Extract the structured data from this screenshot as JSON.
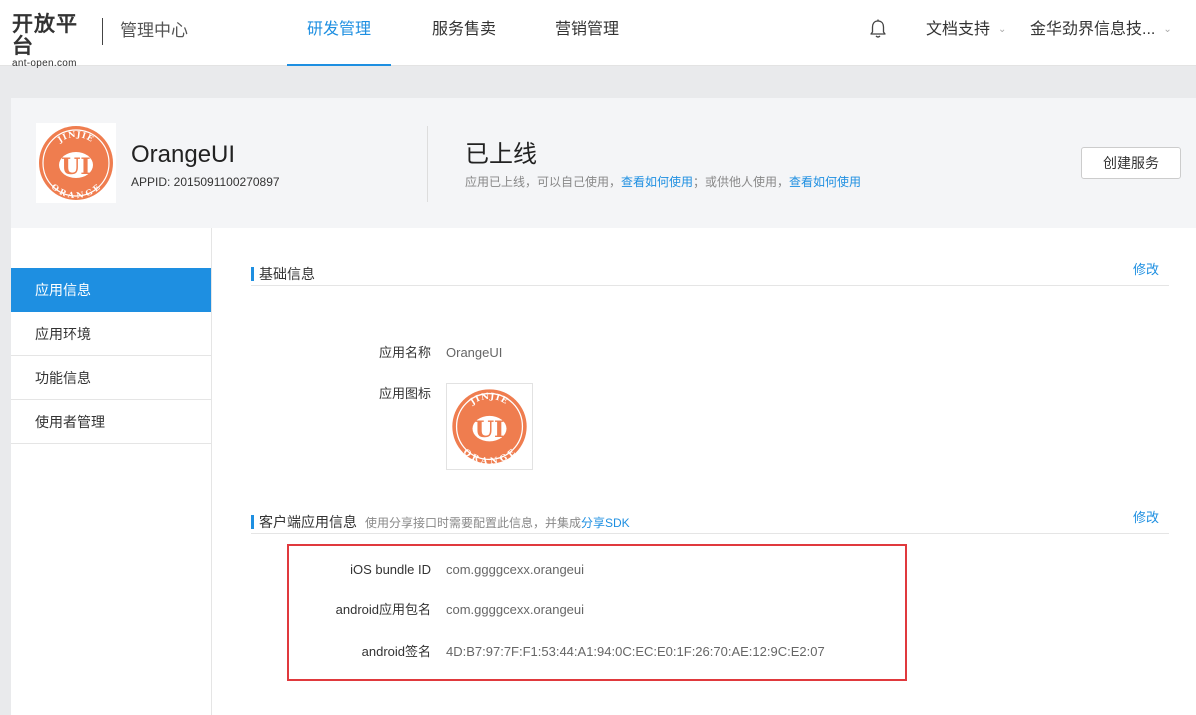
{
  "topbar": {
    "logo_main": "开放平台",
    "logo_sub": "ant-open.com",
    "mgmt_center": "管理中心",
    "nav": [
      {
        "label": "研发管理",
        "active": true
      },
      {
        "label": "服务售卖",
        "active": false
      },
      {
        "label": "营销管理",
        "active": false
      }
    ],
    "docs_label": "文档支持",
    "account_label": "金华劲界信息技..."
  },
  "app": {
    "logo_text_top": "JINJIE",
    "logo_text_mid": "UI",
    "logo_text_bottom": "ORANGE",
    "name": "OrangeUI",
    "appid": "APPID: 2015091100270897",
    "status_title": "已上线",
    "status_desc_1": "应用已上线，可以自己使用，",
    "status_link_1": "查看如何使用",
    "status_desc_2": "；或供他人使用，",
    "status_link_2": "查看如何使用",
    "create_button": "创建服务",
    "brand_color": "#ef7d4f"
  },
  "sidebar": {
    "items": [
      {
        "label": "应用信息",
        "active": true
      },
      {
        "label": "应用环境",
        "active": false
      },
      {
        "label": "功能信息",
        "active": false
      },
      {
        "label": "使用者管理",
        "active": false
      }
    ]
  },
  "basic": {
    "title": "基础信息",
    "edit": "修改",
    "name_label": "应用名称",
    "name_value": "OrangeUI",
    "icon_label": "应用图标"
  },
  "client": {
    "title": "客户端应用信息",
    "note_prefix": "使用分享接口时需要配置此信息，并集成",
    "note_link": "分享SDK",
    "edit": "修改",
    "ios_label": "iOS bundle ID",
    "ios_value": "com.ggggcexx.orangeui",
    "android_pkg_label": "android应用包名",
    "android_pkg_value": "com.ggggcexx.orangeui",
    "android_sig_label": "android签名",
    "android_sig_value": "4D:B7:97:7F:F1:53:44:A1:94:0C:EC:E0:1F:26:70:AE:12:9C:E2:07"
  },
  "colors": {
    "accent": "#1e8fe1",
    "highlight": "#e0393d"
  }
}
